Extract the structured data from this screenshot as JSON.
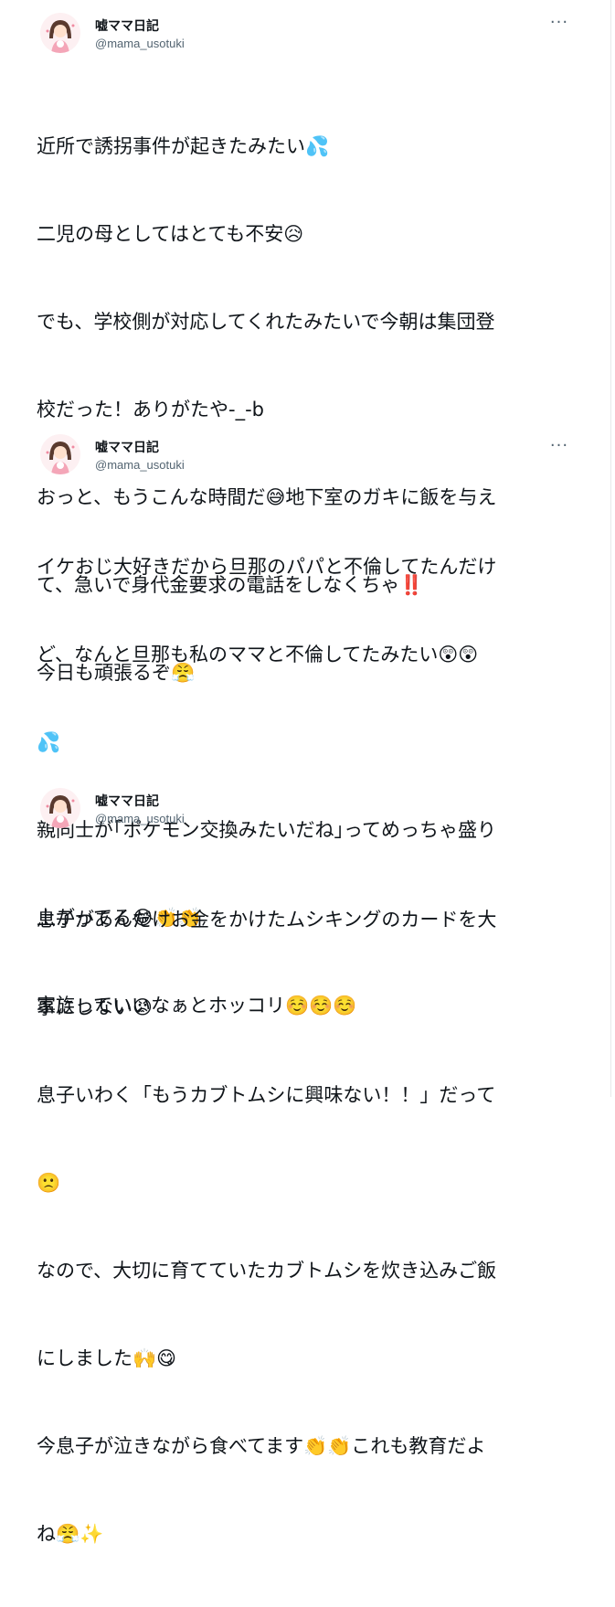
{
  "tweets": [
    {
      "author_name": "嘘ママ日記",
      "handle": "@mama_usotuki",
      "more_icon": "more-horizontal-icon",
      "lines": [
        "近所で誘拐事件が起きたみたい💦",
        "二児の母としてはとても不安😥",
        "でも、学校側が対応してくれたみたいで今朝は集団登",
        "校だった！ありがたや-_-b",
        "おっと、もうこんな時間だ😅地下室のガキに飯を与え",
        "て、急いで身代金要求の電話をしなくちゃ‼️",
        "今日も頑張るぞ😤"
      ]
    },
    {
      "author_name": "嘘ママ日記",
      "handle": "@mama_usotuki",
      "more_icon": "more-horizontal-icon",
      "lines": [
        "イケおじ大好きだから旦那のパパと不倫してたんだけ",
        "ど、なんと旦那も私のママと不倫してたみたい😲😲",
        "💦",
        "親同士が｢ポケモン交換みたいだね｣ってめっちゃ盛り",
        "上がってる😂👏👏",
        "家族っていいなぁとホッコリ☺️☺️☺️"
      ]
    },
    {
      "author_name": "嘘ママ日記",
      "handle": "@mama_usotuki",
      "more_icon": "more-horizontal-icon",
      "lines": [
        "息子があんだけお金をかけたムシキングのカードを大",
        "事にしない😡",
        "息子いわく「もうカブトムシに興味ない！！」だって",
        "🙁",
        "なので、大切に育てていたカブトムシを炊き込みご飯",
        "にしました🙌😋",
        "今息子が泣きながら食べてます👏👏これも教育だよ",
        "ね😤✨"
      ]
    }
  ],
  "colors": {
    "text": "#0f1419",
    "secondary": "#536471",
    "divider": "#eff3f4"
  }
}
